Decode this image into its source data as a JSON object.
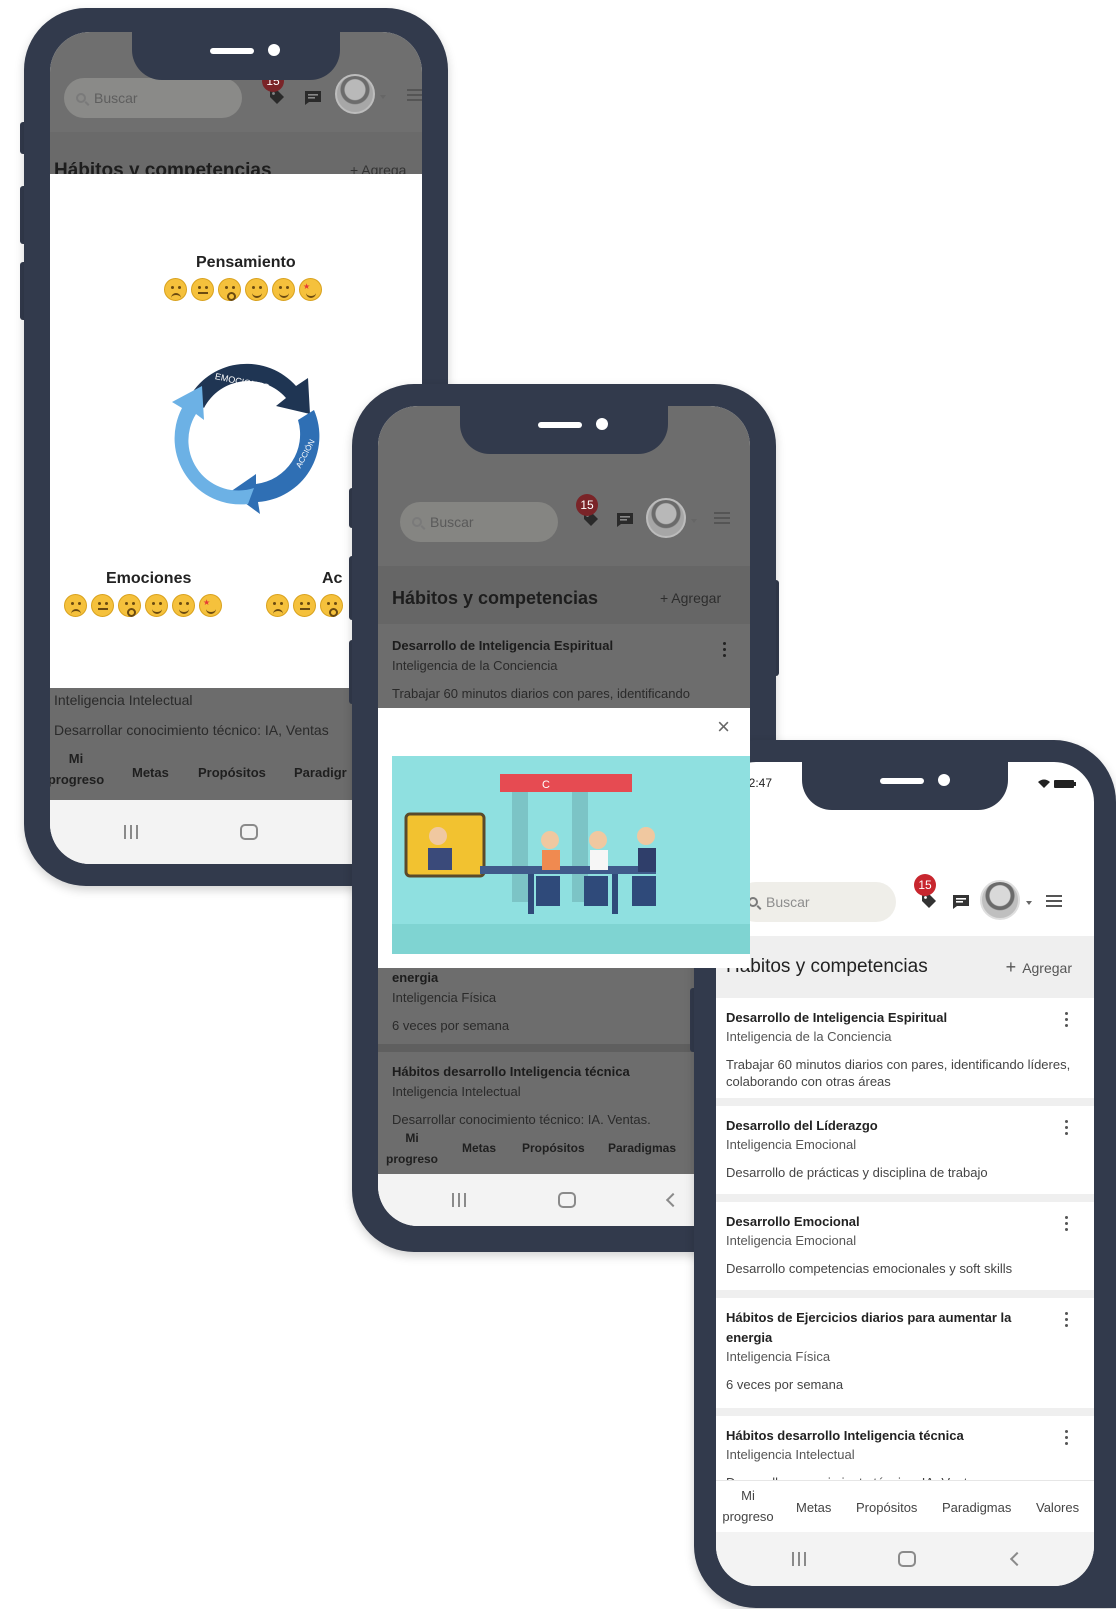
{
  "app": {
    "search_placeholder": "Buscar",
    "badge_count": "15",
    "section_title": "Hábitos y competencias",
    "add_label": "Agregar"
  },
  "status": {
    "time": "22:47"
  },
  "cards": [
    {
      "title": "Desarrollo de Inteligencia Espiritual",
      "subtitle": "Inteligencia de la Conciencia",
      "desc": "Trabajar 60 minutos diarios con pares, identificando líderes, colaborando con otras áreas"
    },
    {
      "title": "Desarrollo del Líderazgo",
      "subtitle": "Inteligencia Emocional",
      "desc": "Desarrollo de prácticas y disciplina de trabajo"
    },
    {
      "title": "Desarrollo Emocional",
      "subtitle": "Inteligencia Emocional",
      "desc": "Desarrollo competencias emocionales y soft skills"
    },
    {
      "title": "Hábitos de Ejercicios diarios para aumentar la energia",
      "subtitle": "Inteligencia Física",
      "desc": "6 veces por semana"
    },
    {
      "title": "Hábitos desarrollo Inteligencia técnica",
      "subtitle": "Inteligencia Intelectual",
      "desc": "Desarrollar conocimiento técnico: IA, Ventas,"
    }
  ],
  "phone2": {
    "card1_desc_line": "Trabajar 60 minutos diarios con pares, identificando",
    "card4_tail": "energia"
  },
  "phone1": {
    "partial_header": "Hábitos y competencias",
    "partial_add": "Agrega",
    "pensamiento": "Pensamiento",
    "emociones": "Emociones",
    "accion_partial": "Ac",
    "cycle_top": "EMOCIONES",
    "cycle_left": "PENSAMIENTO",
    "cycle_right": "ACCIÓN",
    "behind_sub": "Inteligencia Intelectual",
    "behind_desc": "Desarrollar conocimiento técnico: IA, Ventas"
  },
  "tabs": {
    "mi": "Mi",
    "progreso": "progreso",
    "metas": "Metas",
    "propositos": "Propósitos",
    "paradigmas": "Paradigmas",
    "paradigmas_partial2": "Paradigmas",
    "paradigmas_partial1": "Paradigr",
    "valores": "Valores"
  },
  "modal": {
    "close": "×",
    "banner_letters": "C"
  },
  "colors": {
    "frame": "#323a4c",
    "badge": "#c8262e",
    "arrow_dark": "#1f3553",
    "arrow_mid": "#2f6fb4",
    "arrow_light": "#6cb1e5"
  }
}
